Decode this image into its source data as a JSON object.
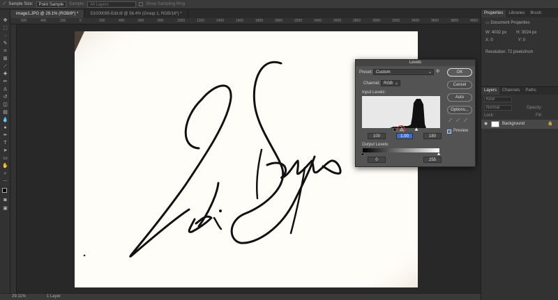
{
  "options_bar": {
    "sample_size_label": "Sample Size:",
    "sample_size_value": "Point Sample",
    "sample_label": "Sample:",
    "sample_value": "All Layers",
    "show_ring_label": "Show Sampling Ring"
  },
  "tabs": [
    {
      "label": "image1.JPG @ 29.1% (RGB/8*) *",
      "active": true
    },
    {
      "label": "D1000085-Edit.tif @ 56.4% (Group 1, RGB/16*) *",
      "active": false
    }
  ],
  "ruler_ticks": [
    "600",
    "400",
    "200",
    "0",
    "200",
    "400",
    "600",
    "800",
    "1000",
    "1200",
    "1400",
    "1600",
    "1800",
    "2000",
    "2200",
    "2400",
    "2600",
    "2800",
    "3000",
    "3200",
    "3400",
    "3600",
    "3800",
    "4000"
  ],
  "status": {
    "zoom": "29.11%",
    "layers": "1 Layer"
  },
  "levels": {
    "title": "Levels",
    "preset_label": "Preset:",
    "preset_value": "Custom",
    "channel_label": "Channel:",
    "channel_value": "RGB",
    "input_label": "Input Levels:",
    "input_black": "100",
    "input_mid": "1.00",
    "input_white": "180",
    "output_label": "Output Levels:",
    "output_black": "0",
    "output_white": "255",
    "ok": "OK",
    "cancel": "Cancel",
    "auto": "Auto",
    "options": "Options...",
    "preview": "Preview"
  },
  "properties": {
    "tabs": [
      "Properties",
      "Libraries",
      "Brush"
    ],
    "doc_props": "Document Properties",
    "w": "W: 4032 px",
    "h": "H: 3024 px",
    "x": "X: 0",
    "y": "Y: 0",
    "resolution": "Resolution: 72 pixels/inch"
  },
  "layers_panel": {
    "tabs": [
      "Layers",
      "Channels",
      "Paths"
    ],
    "kind": "Kind",
    "mode": "Normal",
    "opacity": "Opacity:",
    "lock": "Lock:",
    "fill": "Fill:",
    "layer_name": "Background"
  }
}
